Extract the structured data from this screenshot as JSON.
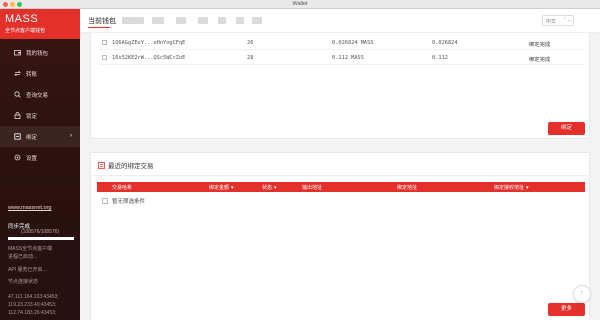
{
  "window": {
    "title": "Wallet"
  },
  "brand": {
    "title": "MASS",
    "subtitle": "全节点客户端钱包"
  },
  "sidebar": {
    "items": [
      {
        "label": "我的钱包",
        "icon": "wallet-icon",
        "active": false
      },
      {
        "label": "转账",
        "icon": "transfer-icon",
        "active": false
      },
      {
        "label": "查询交易",
        "icon": "search-icon",
        "active": false
      },
      {
        "label": "锁定",
        "icon": "lock-icon",
        "active": false
      },
      {
        "label": "绑定",
        "icon": "bind-icon",
        "active": true
      },
      {
        "label": "设置",
        "icon": "gear-icon",
        "active": false
      }
    ],
    "expand_arrow": "›",
    "site_link": "www.massnet.org",
    "sync_title": "同步完成",
    "sync_count": "(108576/108576)",
    "sync_progress": 1.0,
    "status_lines": [
      "MASS全节点客户端",
      "进程已启动...",
      "API 服务已开启...",
      "节点连接状态"
    ],
    "peers": [
      "47.111.164.103:43453;",
      "119.23.233.40:43453;",
      "112.74.183.26:43453;"
    ]
  },
  "topbar": {
    "current_wallet": "当前钱包",
    "language": "中文",
    "language_chevron": "⌃⌄"
  },
  "bind_list": {
    "rows": [
      {
        "address": "1Q6AGgZEeY...eHnYogCFqE",
        "number": "26",
        "amount": "0.026824 MASS",
        "amount2": "0.026824",
        "status": "绑定完成"
      },
      {
        "address": "16x52KE2rW...QSc5WCcZoE",
        "number": "28",
        "amount": "0.112 MASS",
        "amount2": "0.112",
        "status": "绑定完成"
      }
    ],
    "bind_button": "绑定"
  },
  "recent": {
    "title": "最近的绑定交易",
    "columns": [
      {
        "label": "交易哈希",
        "caret": false
      },
      {
        "label": "绑定金额",
        "caret": true
      },
      {
        "label": "状态",
        "caret": true
      },
      {
        "label": "输出地址",
        "caret": false
      },
      {
        "label": "绑定地址",
        "caret": false
      },
      {
        "label": "绑定接收地址",
        "caret": true
      }
    ],
    "caret_glyph": "▼",
    "empty_text": "暂无筛选条件",
    "more_button": "更多"
  },
  "scroll_top": {
    "glyph": "↑"
  },
  "colors": {
    "accent": "#e4302b",
    "sidebar_bg": "#2c1210"
  }
}
